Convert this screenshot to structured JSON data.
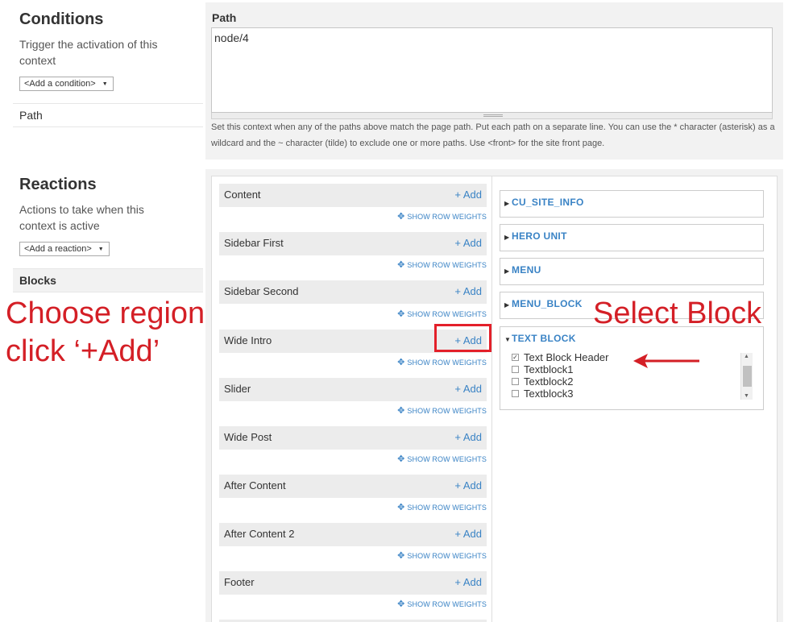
{
  "conditions": {
    "title": "Conditions",
    "description": "Trigger the activation of this context",
    "add_select": "<Add a condition>",
    "items": [
      "Path"
    ]
  },
  "reactions": {
    "title": "Reactions",
    "description": "Actions to take when this context is active",
    "add_select": "<Add a reaction>",
    "items": [
      "Blocks"
    ]
  },
  "path": {
    "label": "Path",
    "value": "node/4",
    "help": "Set this context when any of the paths above match the page path. Put each path on a separate line. You can use the * character (asterisk) as a wildcard and the ~ character (tilde) to exclude one or more paths. Use <front> for the site front page."
  },
  "regions": {
    "add_label": "+ Add",
    "weights_label": "SHOW ROW WEIGHTS",
    "items": [
      "Content",
      "Sidebar First",
      "Sidebar Second",
      "Wide Intro",
      "Slider",
      "Wide Post",
      "After Content",
      "After Content 2",
      "Footer"
    ]
  },
  "blocks": {
    "categories": [
      "CU_SITE_INFO",
      "HERO UNIT",
      "MENU",
      "MENU_BLOCK",
      "TEXT BLOCK"
    ],
    "text_block_items": [
      {
        "label": "Text Block Header",
        "checked": true
      },
      {
        "label": "Textblock1",
        "checked": false
      },
      {
        "label": "Textblock2",
        "checked": false
      },
      {
        "label": "Textblock3",
        "checked": false
      }
    ]
  },
  "annotations": {
    "left_line1": "Choose region",
    "left_line2": "click ‘+Add’",
    "right": "Select Block",
    "color": "#d41f26"
  },
  "colors": {
    "link": "#3a83c5",
    "panel_bg": "#f2f2f2",
    "highlight": "#e3202a"
  }
}
